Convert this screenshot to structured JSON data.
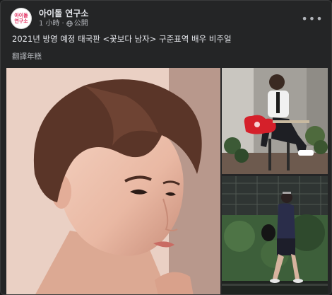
{
  "page": {
    "avatar_text_line1": "아이돌",
    "avatar_text_line2": "연구소",
    "name": "아이돌 연구소",
    "time": "1 小時",
    "audience": "公開"
  },
  "post": {
    "caption": "2021년 방영 예정 태국판 <꽃보다 남자> 구준표역 배우 비주얼",
    "translate_label": "翻譯年糕"
  },
  "icons": {
    "globe": "globe-icon",
    "more": "more-options-icon"
  },
  "colors": {
    "card_bg": "#242526",
    "text_primary": "#e4e6eb",
    "text_secondary": "#b0b3b8",
    "accent_guitar": "#d5202a",
    "avatar_text": "#e0265a"
  }
}
